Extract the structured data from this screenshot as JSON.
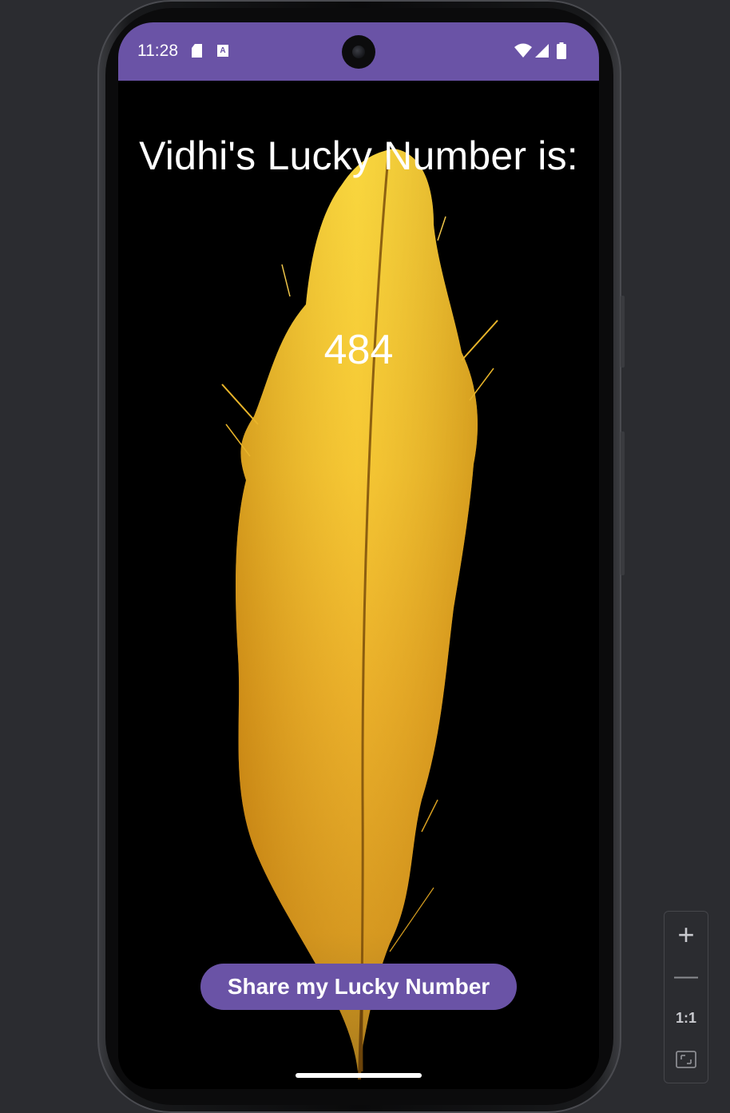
{
  "status_bar": {
    "time": "11:28",
    "icons": [
      "sd-card-icon",
      "a-notification-icon",
      "wifi-icon",
      "signal-icon",
      "battery-icon"
    ],
    "background_color": "#6a53a6"
  },
  "app": {
    "title": "Vidhi's Lucky Number is:",
    "lucky_number": "484",
    "share_button_label": "Share my Lucky Number",
    "accent_color": "#6a53a6",
    "background_image": "golden-feather"
  },
  "zoom_toolbar": {
    "zoom_in_label": "+",
    "zoom_out_label": "—",
    "actual_size_label": "1:1",
    "fit_icon": "fit-screen-icon"
  }
}
